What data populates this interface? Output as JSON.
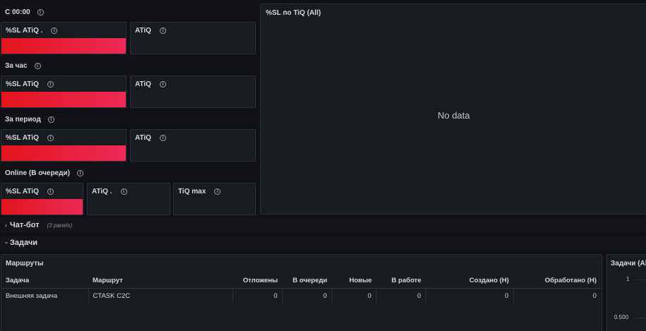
{
  "sections": {
    "since_midnight": "С 00:00",
    "per_hour": "За час",
    "per_period": "За период",
    "online": "Online (В очереди)"
  },
  "stat_panels": {
    "sl_atiq_dot": "%SL ATiQ .",
    "sl_atiq": "%SL ATiQ",
    "atiq": "ATiQ",
    "atiq_dot": "ATiQ .",
    "tiq_max": "TiQ max"
  },
  "chart_panel": {
    "title": "%SL по TiQ (All)",
    "no_data": "No data"
  },
  "rows": {
    "chatbot": {
      "chevron": "›",
      "title": "Чат-бот",
      "sub": "(3 panels)"
    },
    "tasks": {
      "chevron": "‹",
      "title": "Задачи"
    }
  },
  "routes_panel": {
    "title": "Маршруты",
    "columns": [
      "Задача",
      "Маршрут",
      "Отложены",
      "В очереди",
      "Новые",
      "В работе",
      "Создано (Н)",
      "Обработано (Н)"
    ],
    "rows": [
      [
        "Внешняя задача",
        "CTASK C2C",
        "0",
        "0",
        "0",
        "0",
        "0",
        "0"
      ]
    ]
  },
  "right_panel": {
    "title": "Задачи (All",
    "ticks": [
      "1",
      "0.500"
    ]
  },
  "icons": {
    "info": "info-circle-icon"
  },
  "colors": {
    "bar_start": "#e3141c",
    "bar_end": "#ec2a56",
    "background": "#111217",
    "panel": "#181b1f"
  }
}
